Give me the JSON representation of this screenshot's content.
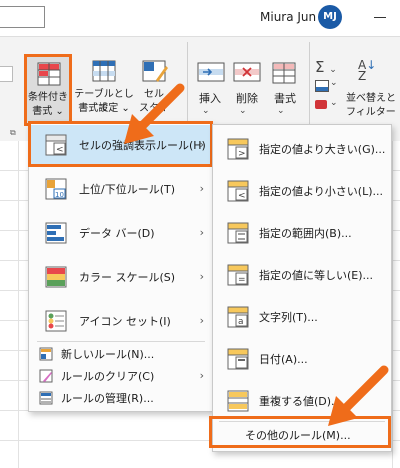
{
  "user": {
    "name": "Miura Jun",
    "initials": "MJ"
  },
  "ribbon": {
    "conditional_format": {
      "line1": "条件付き",
      "line2": "書式 ⌄"
    },
    "format_as_table": {
      "line1": "テーブルとして",
      "line2": "書式設定 ⌄"
    },
    "cell_styles": {
      "line1": "セル",
      "line2": "スタイル ⌄"
    },
    "insert": "挿入",
    "delete": "削除",
    "format": "書式",
    "sort_filter": {
      "line1": "並べ替えと",
      "line2": "フィルター ⌄"
    }
  },
  "menu": {
    "items": [
      {
        "label": "セルの強調表示ルール(H)",
        "icon": "highlight-rules-icon"
      },
      {
        "label": "上位/下位ルール(T)",
        "icon": "top-bottom-icon"
      },
      {
        "label": "データ バー(D)",
        "icon": "data-bars-icon"
      },
      {
        "label": "カラー スケール(S)",
        "icon": "color-scales-icon"
      },
      {
        "label": "アイコン セット(I)",
        "icon": "icon-sets-icon"
      }
    ],
    "small_items": [
      {
        "label": "新しいルール(N)...",
        "icon": "new-rule-icon"
      },
      {
        "label": "ルールのクリア(C)",
        "icon": "clear-rules-icon"
      },
      {
        "label": "ルールの管理(R)...",
        "icon": "manage-rules-icon"
      }
    ]
  },
  "submenu": {
    "items": [
      {
        "label": "指定の値より大きい(G)...",
        "icon": "greater-than-icon"
      },
      {
        "label": "指定の値より小さい(L)...",
        "icon": "less-than-icon"
      },
      {
        "label": "指定の範囲内(B)...",
        "icon": "between-icon"
      },
      {
        "label": "指定の値に等しい(E)...",
        "icon": "equal-to-icon"
      },
      {
        "label": "文字列(T)...",
        "icon": "text-contains-icon"
      },
      {
        "label": "日付(A)...",
        "icon": "date-occurring-icon"
      },
      {
        "label": "重複する値(D)...",
        "icon": "duplicate-values-icon"
      }
    ],
    "more_rules": "その他のルール(M)..."
  },
  "colors": {
    "accent": "#ef6c1a",
    "highlight": "#cde6f7",
    "avatar": "#1a5aa6"
  }
}
